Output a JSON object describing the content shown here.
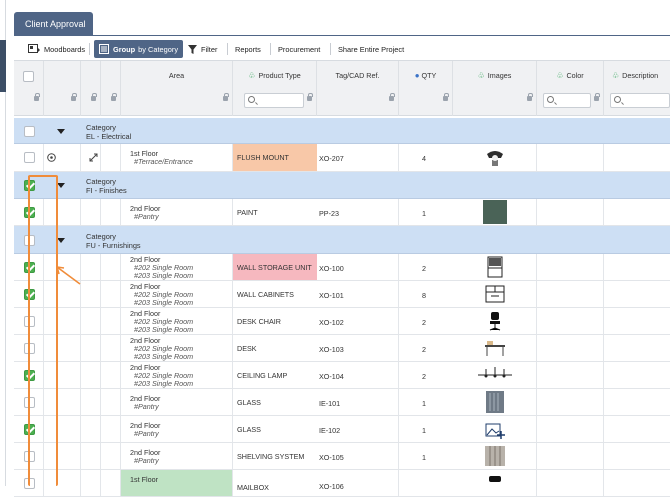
{
  "tab": {
    "label": "Client Approval"
  },
  "toolbar": {
    "moodboards": "Moodboards",
    "group_prefix": "Group",
    "group_suffix": "by Category",
    "filter": "Filter",
    "reports": "Reports",
    "procurement": "Procurement",
    "share": "Share Entire Project"
  },
  "columns": {
    "area": "Area",
    "product_type": "Product Type",
    "tag": "Tag/CAD Ref.",
    "qty": "QTY",
    "images": "Images",
    "color": "Color",
    "description": "Description"
  },
  "categories": {
    "el": {
      "line1": "Category",
      "line2": "EL - Electrical"
    },
    "fi": {
      "line1": "Category",
      "line2": "FI - Finishes"
    },
    "fu": {
      "line1": "Category",
      "line2": "FU - Furnishings"
    }
  },
  "rows": [
    {
      "floor": "1st Floor",
      "sub1": "#Terrace/Entrance",
      "sub2": "",
      "type": "FLUSH MOUNT",
      "type_bg": "#f8c8a8",
      "tag": "XO-207",
      "qty": "4",
      "checked": false,
      "img": "lamp-image"
    },
    {
      "floor": "2nd Floor",
      "sub1": "#Pantry",
      "sub2": "",
      "type": "PAINT",
      "type_bg": "",
      "tag": "PP-23",
      "qty": "1",
      "checked": true,
      "img": "paint-swatch"
    },
    {
      "floor": "2nd Floor",
      "sub1": "#202 Single Room",
      "sub2": "#203 Single Room",
      "type": "WALL STORAGE UNIT",
      "type_bg": "#f6b8bf",
      "tag": "XO-100",
      "qty": "2",
      "checked": true,
      "img": "storage-unit-image"
    },
    {
      "floor": "2nd Floor",
      "sub1": "#202 Single Room",
      "sub2": "#203 Single Room",
      "type": "WALL CABINETS",
      "type_bg": "",
      "tag": "XO-101",
      "qty": "8",
      "checked": true,
      "img": "wall-cabinet-image"
    },
    {
      "floor": "2nd Floor",
      "sub1": "#202 Single Room",
      "sub2": "#203 Single Room",
      "type": "DESK CHAIR",
      "type_bg": "",
      "tag": "XO-102",
      "qty": "2",
      "checked": false,
      "img": "desk-chair-image"
    },
    {
      "floor": "2nd Floor",
      "sub1": "#202 Single Room",
      "sub2": "#203 Single Room",
      "type": "DESK",
      "type_bg": "",
      "tag": "XO-103",
      "qty": "2",
      "checked": false,
      "img": "desk-image"
    },
    {
      "floor": "2nd Floor",
      "sub1": "#202 Single Room",
      "sub2": "#203 Single Room",
      "type": "CEILING LAMP",
      "type_bg": "",
      "tag": "XO-104",
      "qty": "2",
      "checked": true,
      "img": "ceiling-lamp-image"
    },
    {
      "floor": "2nd Floor",
      "sub1": "#Pantry",
      "sub2": "",
      "type": "GLASS",
      "type_bg": "",
      "tag": "IE-101",
      "qty": "1",
      "checked": false,
      "img": "glass-image"
    },
    {
      "floor": "2nd Floor",
      "sub1": "#Pantry",
      "sub2": "",
      "type": "GLASS",
      "type_bg": "",
      "tag": "IE-102",
      "qty": "1",
      "checked": true,
      "img": "glass-image-add"
    },
    {
      "floor": "2nd Floor",
      "sub1": "#Pantry",
      "sub2": "",
      "type": "SHELVING SYSTEM",
      "type_bg": "",
      "tag": "XO-105",
      "qty": "1",
      "checked": false,
      "img": "shelving-image"
    },
    {
      "floor": "1st Floor",
      "sub1": "",
      "sub2": "",
      "type": "MAILBOX",
      "type_bg": "",
      "tag": "XO-106",
      "qty": "",
      "checked": false,
      "img": "mailbox-image"
    }
  ]
}
